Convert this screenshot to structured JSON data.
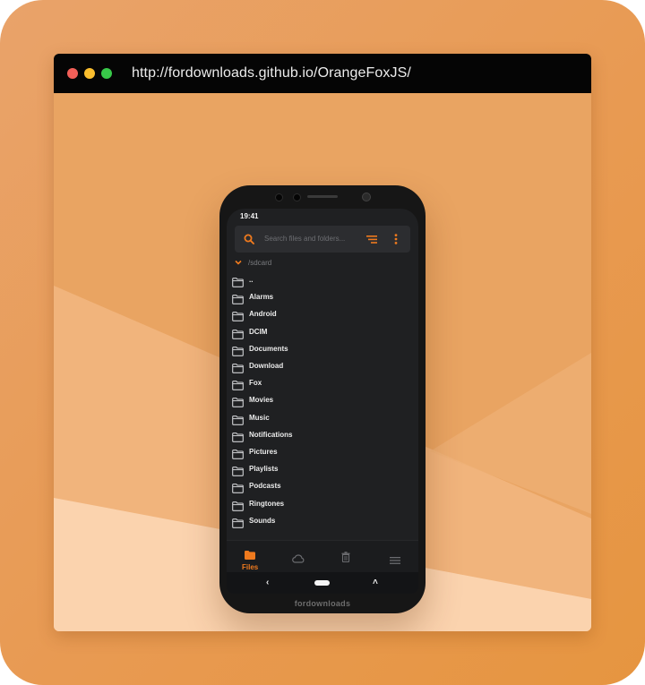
{
  "browser": {
    "url": "http://fordownloads.github.io/OrangeFoxJS/"
  },
  "phone": {
    "status_time": "19:41",
    "search_placeholder": "Search files and folders...",
    "current_path": "/sdcard",
    "files": [
      "..",
      "Alarms",
      "Android",
      "DCIM",
      "Documents",
      "Download",
      "Fox",
      "Movies",
      "Music",
      "Notifications",
      "Pictures",
      "Playlists",
      "Podcasts",
      "Ringtones",
      "Sounds"
    ],
    "nav": {
      "files_label": "Files"
    },
    "brand": "fordownloads"
  },
  "icons": {
    "search": "search-icon",
    "sort": "sort-icon",
    "more": "more-vert-icon",
    "folder": "folder-icon",
    "cloud": "cloud-icon",
    "trash": "trash-icon",
    "menu": "menu-icon"
  },
  "colors": {
    "accent": "#ef7a1e",
    "screen_bg": "#1f2022"
  }
}
